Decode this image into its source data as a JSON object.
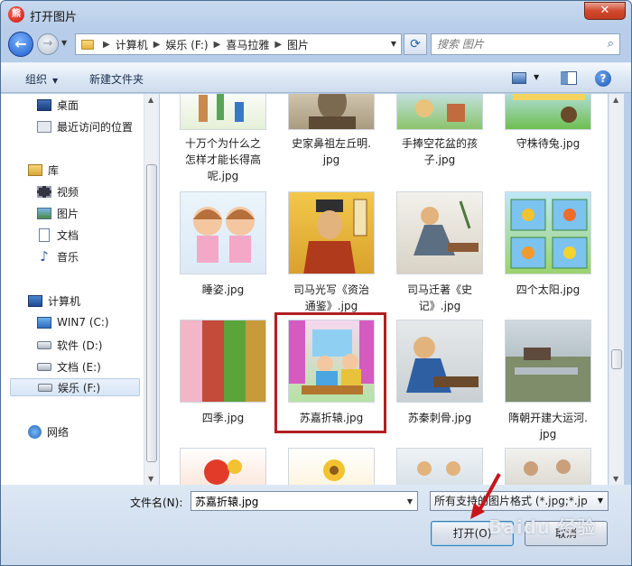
{
  "window": {
    "title": "打开图片",
    "app_icon": "bear-app-icon",
    "close": "✕"
  },
  "nav": {
    "breadcrumb": [
      "计算机",
      "娱乐 (F:)",
      "喜马拉雅",
      "图片"
    ],
    "search_placeholder": "搜索 图片"
  },
  "toolbar": {
    "organize": "组织",
    "new_folder": "新建文件夹"
  },
  "sidebar": {
    "items": [
      {
        "label": "桌面",
        "icon": "desktop-icon"
      },
      {
        "label": "最近访问的位置",
        "icon": "recent-places-icon"
      },
      {
        "label": "库",
        "icon": "library-icon"
      },
      {
        "label": "视频",
        "icon": "video-icon"
      },
      {
        "label": "图片",
        "icon": "pictures-icon"
      },
      {
        "label": "文档",
        "icon": "documents-icon"
      },
      {
        "label": "音乐",
        "icon": "music-icon"
      },
      {
        "label": "计算机",
        "icon": "computer-icon"
      },
      {
        "label": "WIN7 (C:)",
        "icon": "system-drive-icon"
      },
      {
        "label": "软件 (D:)",
        "icon": "drive-icon"
      },
      {
        "label": "文档 (E:)",
        "icon": "drive-icon"
      },
      {
        "label": "娱乐 (F:)",
        "icon": "drive-icon",
        "selected": true
      },
      {
        "label": "网络",
        "icon": "network-icon"
      }
    ]
  },
  "files": [
    {
      "line1": "十万个为什么之",
      "line2": "怎样才能长得高",
      "line3": "呢.jpg"
    },
    {
      "line1": "史家鼻祖左丘明.",
      "line2": "jpg",
      "line3": ""
    },
    {
      "line1": "手捧空花盆的孩",
      "line2": "子.jpg",
      "line3": ""
    },
    {
      "line1": "守株待兔.jpg",
      "line2": "",
      "line3": ""
    },
    {
      "line1": "睡姿.jpg",
      "line2": "",
      "line3": ""
    },
    {
      "line1": "司马光写《资治",
      "line2": "通鉴》.jpg",
      "line3": ""
    },
    {
      "line1": "司马迁著《史",
      "line2": "记》.jpg",
      "line3": ""
    },
    {
      "line1": "四个太阳.jpg",
      "line2": "",
      "line3": ""
    },
    {
      "line1": "四季.jpg",
      "line2": "",
      "line3": ""
    },
    {
      "line1": "苏嘉折辕.jpg",
      "line2": "",
      "line3": "",
      "selected": true
    },
    {
      "line1": "苏秦刺骨.jpg",
      "line2": "",
      "line3": ""
    },
    {
      "line1": "隋朝开建大运河.",
      "line2": "jpg",
      "line3": ""
    }
  ],
  "bottom": {
    "filename_label": "文件名(N):",
    "filename_value": "苏嘉折辕.jpg",
    "filetype_value": "所有支持的图片格式 (*.jpg;*.jp",
    "open_label": "打开(O)",
    "cancel_label": "取消"
  },
  "watermark": "Baidu 经验",
  "colors": {
    "highlight": "#b21e23",
    "pointer": "#c8151b",
    "accent": "#1d5cc9"
  }
}
